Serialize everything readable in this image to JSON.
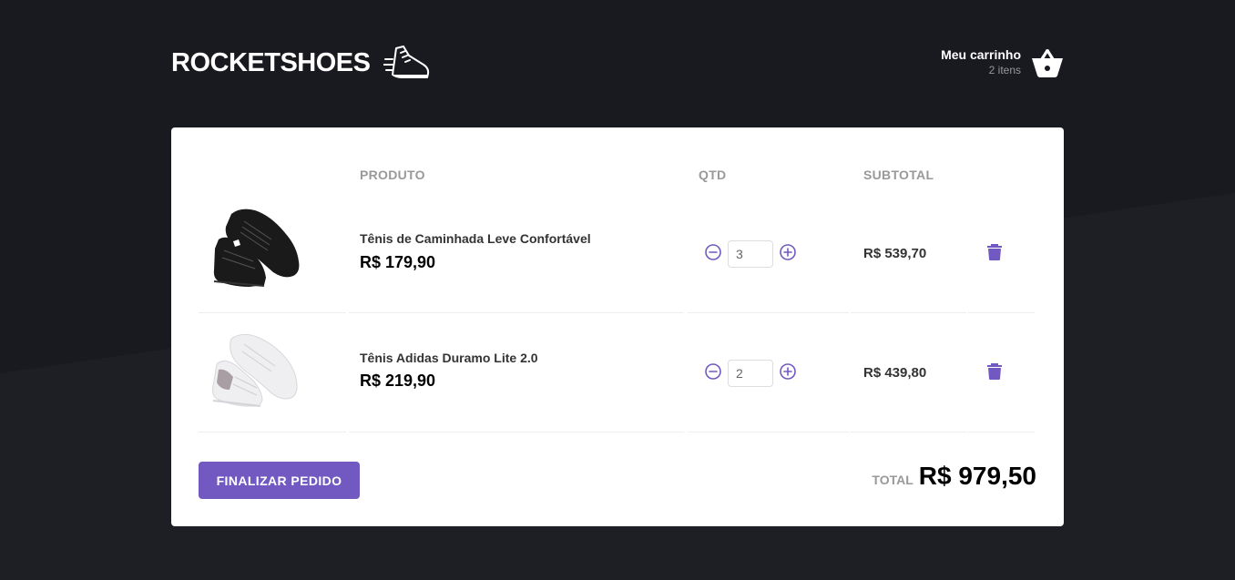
{
  "header": {
    "logo_text": "ROCKETSHOES",
    "cart_title": "Meu carrinho",
    "cart_count": "2 itens"
  },
  "table": {
    "col_product": "PRODUTO",
    "col_qty": "QTD",
    "col_subtotal": "SUBTOTAL"
  },
  "items": [
    {
      "name": "Tênis de Caminhada Leve Confortável",
      "price": "R$ 179,90",
      "quantity": "3",
      "subtotal": "R$ 539,70",
      "shoe_color": "#1a1a1a"
    },
    {
      "name": "Tênis Adidas Duramo Lite 2.0",
      "price": "R$ 219,90",
      "quantity": "2",
      "subtotal": "R$ 439,80",
      "shoe_color": "#f0f0f2"
    }
  ],
  "footer": {
    "checkout_label": "FINALIZAR PEDIDO",
    "total_label": "TOTAL",
    "total_value": "R$ 979,50"
  },
  "colors": {
    "background": "#191920",
    "background_shape": "#1e1e25",
    "accent": "#7159c1",
    "panel": "#ffffff"
  }
}
